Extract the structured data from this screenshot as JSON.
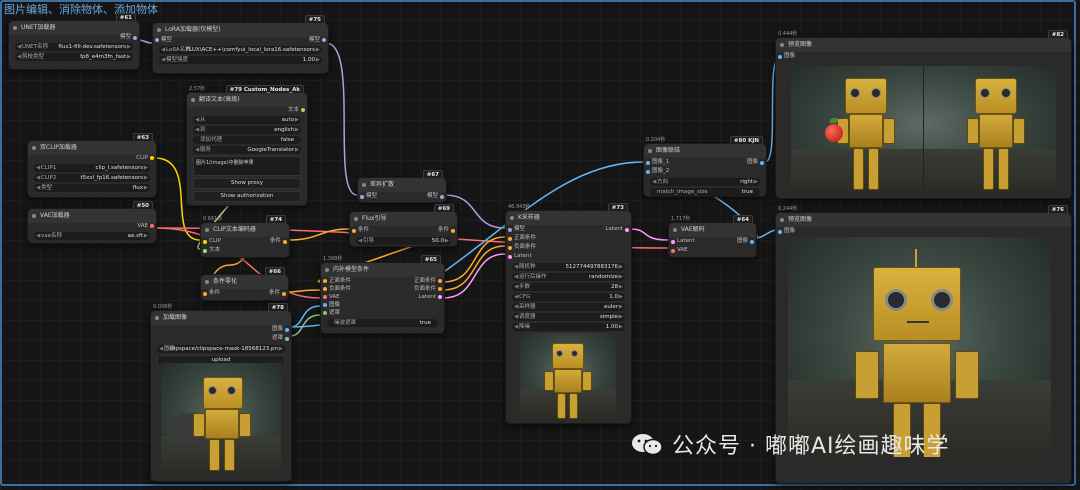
{
  "group": {
    "title": "图片编辑、消除物体、添加物体"
  },
  "nodes": {
    "unet": {
      "id": "#61",
      "title": "UNET加载器",
      "out_label": "模型",
      "widgets": [
        {
          "label": "UNET名称",
          "value": "flux1-fill-dev.safetensors"
        },
        {
          "label": "剪枝类型",
          "value": "fp8_e4m3fn_fast"
        }
      ]
    },
    "lora": {
      "id": "#75",
      "title": "LoRA加载器(仅模型)",
      "in_label": "模型",
      "out_label": "模型",
      "widgets": [
        {
          "label": "LoRA名称",
          "value": "FLUX\\ACE++\\comfyui_local_lora16.safetensors"
        },
        {
          "label": "模型强度",
          "value": "1.00"
        }
      ]
    },
    "translate": {
      "id": "#79 Custom_Nodes_Ak",
      "badge2": "#79",
      "time": "2.57秒",
      "title": "翻译文本(高级)",
      "out_label": "文本",
      "widgets": [
        {
          "label": "从",
          "value": "auto"
        },
        {
          "label": "到",
          "value": "english"
        },
        {
          "label": "添加代理",
          "value": "false"
        },
        {
          "label": "服务",
          "value": "GoogleTranslator"
        }
      ],
      "text": "图片1(image)中删除苹果",
      "buttons": [
        "Show proxy",
        "Show authorization"
      ]
    },
    "dualclip": {
      "id": "#63",
      "title": "双CLIP加载器",
      "out_label": "CLIP",
      "widgets": [
        {
          "label": "CLIP1",
          "value": "clip_l.safetensors"
        },
        {
          "label": "CLIP2",
          "value": "t5xxl_fp16.safetensors"
        },
        {
          "label": "类型",
          "value": "flux"
        }
      ]
    },
    "vaeloader": {
      "id": "#50",
      "title": "VAE加载器",
      "out_label": "VAE",
      "widgets": [
        {
          "label": "vae名称",
          "value": "ae.sft"
        }
      ]
    },
    "clipencode": {
      "id": "#74",
      "time": "0.661秒",
      "title": "CLIP文本编码器",
      "inputs": [
        "CLIP",
        "文本"
      ],
      "out_label": "条件"
    },
    "zeroout": {
      "id": "#66",
      "title": "条件零化",
      "in_label": "条件",
      "out_label": "条件"
    },
    "loadimage": {
      "id": "#78",
      "time": "0.008秒",
      "title": "加载图像",
      "outputs": [
        "图像",
        "遮罩"
      ],
      "widgets": [
        {
          "label": "图像",
          "value": "clipspace/clipspace-mask-18568123.pn"
        }
      ],
      "upload": "upload"
    },
    "diffdiff": {
      "id": "#67",
      "title": "差异扩散",
      "in_label": "模型",
      "out_label": "模型"
    },
    "fluxguide": {
      "id": "#69",
      "title": "Flux引导",
      "in_label": "条件",
      "out_label": "条件",
      "widgets": [
        {
          "label": "引导",
          "value": "50.0"
        }
      ]
    },
    "inpaintcond": {
      "id": "#65",
      "time": "1.368秒",
      "title": "内补模型条件",
      "inputs": [
        "正面条件",
        "负面条件",
        "VAE",
        "图像",
        "遮罩"
      ],
      "outputs": [
        "正面条件",
        "负面条件",
        "Latent"
      ],
      "widgets": [
        {
          "label": "噪波遮罩",
          "value": "true"
        }
      ]
    },
    "ksampler": {
      "id": "#73",
      "time": "46.943秒",
      "title": "K采样器",
      "inputs": [
        "模型",
        "正面条件",
        "负面条件",
        "Latent"
      ],
      "out_label": "Latent",
      "widgets": [
        {
          "label": "随机种",
          "value": "512774497883176"
        },
        {
          "label": "运行后操作",
          "value": "randomize"
        },
        {
          "label": "步数",
          "value": "28"
        },
        {
          "label": "CFG",
          "value": "1.0"
        },
        {
          "label": "采样器",
          "value": "euler"
        },
        {
          "label": "调度器",
          "value": "simple"
        },
        {
          "label": "降噪",
          "value": "1.00"
        }
      ]
    },
    "imgstitch": {
      "id": "#80 KJN",
      "badge2": "#80",
      "time": "0.204秒",
      "title": "图像联结",
      "inputs": [
        "图像_1",
        "图像_2"
      ],
      "out_label": "图像",
      "widgets": [
        {
          "label": "方向",
          "value": "right"
        },
        {
          "label": "match_image_size",
          "value": "true"
        }
      ]
    },
    "vaedecode": {
      "id": "#64",
      "time": "1.717秒",
      "title": "VAE解码",
      "inputs": [
        "Latent",
        "VAE"
      ],
      "out_label": "图像"
    },
    "preview1": {
      "id": "#82",
      "time": "0.444秒",
      "title": "预览图像",
      "in_label": "图像"
    },
    "preview2": {
      "id": "#76",
      "time": "0.244秒",
      "title": "预览图像",
      "in_label": "图像"
    }
  },
  "watermark": {
    "text": "公众号 · 嘟嘟AI绘画趣味学"
  },
  "colors": {
    "model": "#b39ddb",
    "clip": "#ffd500",
    "vae": "#ff6e6e",
    "conditioning": "#ffa931",
    "latent": "#ff9cf9",
    "image": "#64b5f6",
    "mask": "#81c784",
    "text": "#a5d86e"
  }
}
